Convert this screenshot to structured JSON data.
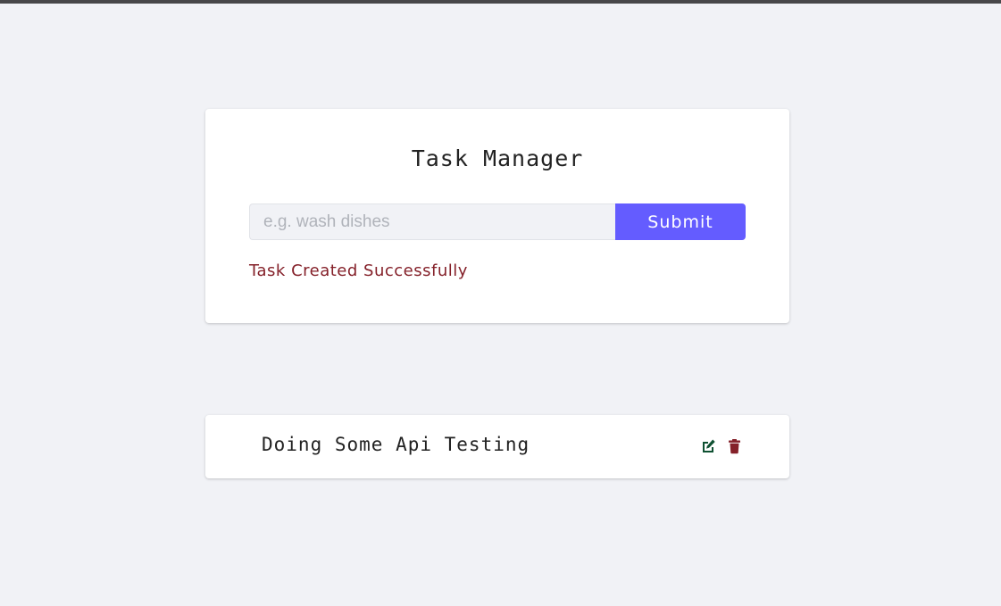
{
  "form": {
    "title": "Task Manager",
    "input_placeholder": "e.g. wash dishes",
    "input_value": "",
    "submit_label": "Submit",
    "alert_text": "Task Created Successfully"
  },
  "tasks": [
    {
      "name": "Doing Some Api Testing",
      "edit_icon": "edit-icon",
      "delete_icon": "trash-icon"
    }
  ],
  "colors": {
    "background": "#f1f2f6",
    "primary": "#645cff",
    "alert_text": "#842029",
    "edit_icon": "#0f5132",
    "delete_icon": "#842029",
    "top_border": "#48484a"
  }
}
